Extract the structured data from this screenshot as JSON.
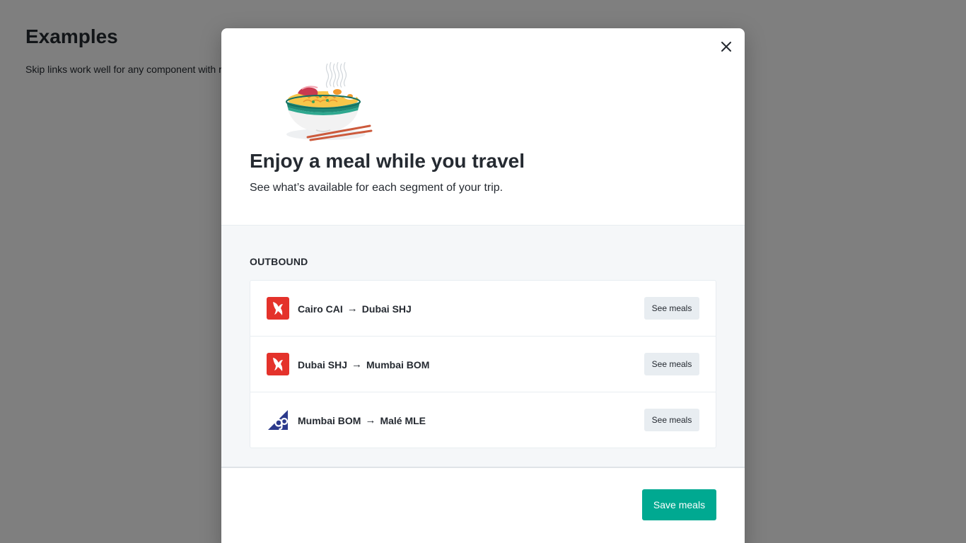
{
  "background": {
    "title": "Examples",
    "text": "Skip links work well for any component with r"
  },
  "modal": {
    "title": "Enjoy a meal while you travel",
    "subtitle": "See what’s available for each segment of your trip.",
    "illustration": "noodle-bowl-illustration",
    "close_icon": "close-icon"
  },
  "outbound": {
    "label": "OUTBOUND",
    "segments": [
      {
        "from": "Cairo CAI",
        "to": "Dubai SHJ",
        "arrow": "→",
        "airline_logo": "air-arabia-logo",
        "button": "See meals"
      },
      {
        "from": "Dubai SHJ",
        "to": "Mumbai BOM",
        "arrow": "→",
        "airline_logo": "air-arabia-logo",
        "button": "See meals"
      },
      {
        "from": "Mumbai BOM",
        "to": "Malé MLE",
        "arrow": "→",
        "airline_logo": "goair-logo",
        "button": "See meals"
      }
    ]
  },
  "footer": {
    "save_label": "Save meals"
  },
  "colors": {
    "accent": "#00a991",
    "text": "#252a31",
    "air_arabia": "#e4322b",
    "goair": "#2c3a8c"
  }
}
